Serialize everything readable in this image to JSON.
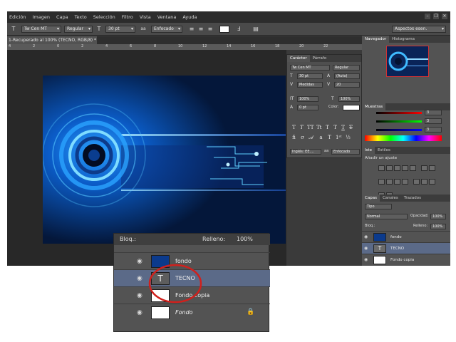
{
  "menu": [
    "Edición",
    "Imagen",
    "Capa",
    "Texto",
    "Selección",
    "Filtro",
    "Vista",
    "Ventana",
    "Ayuda"
  ],
  "options": {
    "font": "Tw Cen MT",
    "style": "Regular",
    "size": "30 pt",
    "aa": "Enfocado",
    "workspace": "Aspectos esen."
  },
  "document_tab": "1-Recuperado al 100% (TECNO, RGB/8) *",
  "ruler": [
    "4",
    "2",
    "0",
    "2",
    "4",
    "6",
    "8",
    "10",
    "12",
    "14",
    "16",
    "18",
    "20",
    "22"
  ],
  "character_panel": {
    "tabs": [
      "Carácter",
      "Párrafo"
    ],
    "font": "Tw Cen MT",
    "style": "Regular",
    "size": "30 pt",
    "leading": "(Auto)",
    "kerning": "Medidas",
    "tracking": "20",
    "vscale": "100%",
    "hscale": "100%",
    "baseline": "0 pt",
    "color_label": "Color:",
    "language": "Inglés: EE....",
    "aa_label": "aa",
    "aa": "Enfocado"
  },
  "navigator": {
    "tabs": [
      "Navegador",
      "Histograma"
    ]
  },
  "color_panel": {
    "tabs": [
      "Muestras"
    ],
    "r": "3",
    "g": "3",
    "b": "3"
  },
  "adjust_panel": {
    "tabs": [
      "Iste",
      "Estilos"
    ],
    "title": "Añadir un ajuste"
  },
  "layers_panel": {
    "tabs": [
      "Capas",
      "Canales",
      "Trazados"
    ],
    "filter": "Tipo",
    "blend": "Normal",
    "opacity_label": "Opacidad:",
    "opacity": "100%",
    "lock_label": "Bloq.:",
    "fill_label": "Relleno:",
    "fill": "100%",
    "layers": [
      {
        "name": "fondo"
      },
      {
        "name": "TECNO"
      },
      {
        "name": "Fondo copia"
      },
      {
        "name": "Fondo"
      }
    ]
  },
  "zoom_panel": {
    "lock_label": "Bloq.:",
    "fill_label": "Relleno:",
    "fill": "100%",
    "layers": [
      {
        "name": "fondo"
      },
      {
        "name": "TECNO"
      },
      {
        "name": "Fondo copia"
      },
      {
        "name": "Fondo"
      }
    ]
  },
  "colors": {
    "ui_dark": "#3a3a3a",
    "selected_layer": "#5b6a88",
    "highlight_circle": "#d0201c"
  }
}
